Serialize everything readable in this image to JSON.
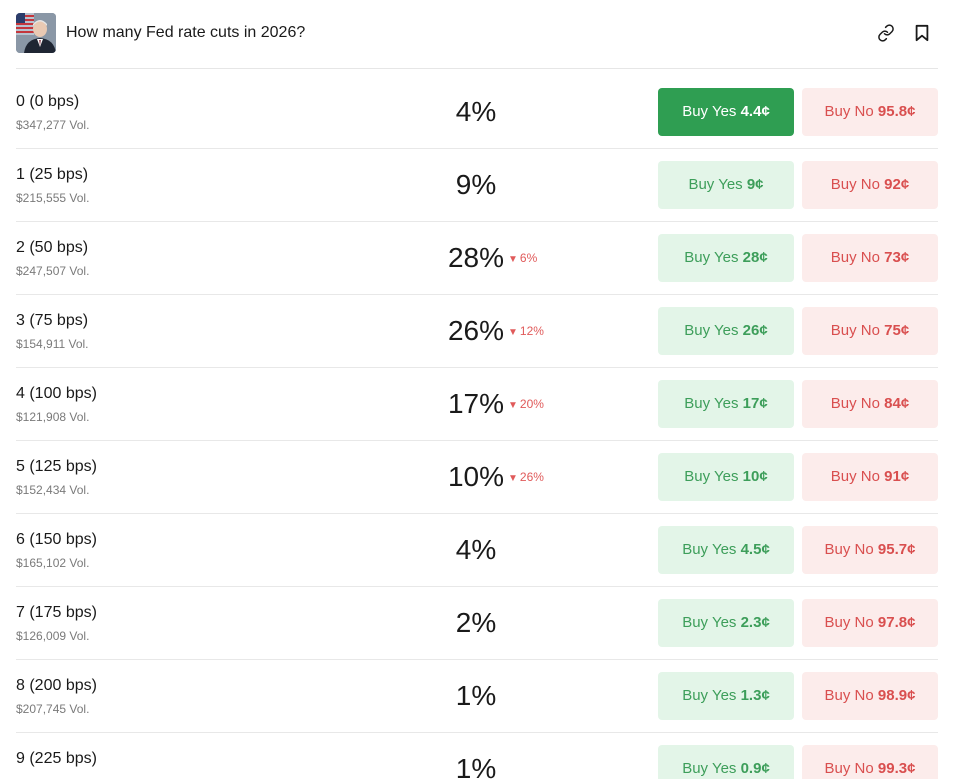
{
  "header": {
    "title": "How many Fed rate cuts in 2026?",
    "icons": {
      "link": "link-icon",
      "bookmark": "bookmark-icon",
      "avatar": "market-avatar"
    }
  },
  "colors": {
    "yes_active_bg": "#2f9e52",
    "yes_bg": "#e3f5e8",
    "yes_text": "#3d9e5a",
    "no_bg": "#fceceb",
    "no_text": "#d94f4f",
    "change_down": "#e05a5a"
  },
  "rows": [
    {
      "label": "0 (0 bps)",
      "vol": "$347,277 Vol.",
      "pct": "4%",
      "change": "",
      "yes_prefix": "Buy Yes",
      "yes_price": "4.4¢",
      "no_prefix": "Buy No",
      "no_price": "95.8¢",
      "yes_active": true
    },
    {
      "label": "1 (25 bps)",
      "vol": "$215,555 Vol.",
      "pct": "9%",
      "change": "",
      "yes_prefix": "Buy Yes",
      "yes_price": "9¢",
      "no_prefix": "Buy No",
      "no_price": "92¢",
      "yes_active": false
    },
    {
      "label": "2 (50 bps)",
      "vol": "$247,507 Vol.",
      "pct": "28%",
      "change": "6%",
      "yes_prefix": "Buy Yes",
      "yes_price": "28¢",
      "no_prefix": "Buy No",
      "no_price": "73¢",
      "yes_active": false
    },
    {
      "label": "3 (75 bps)",
      "vol": "$154,911 Vol.",
      "pct": "26%",
      "change": "12%",
      "yes_prefix": "Buy Yes",
      "yes_price": "26¢",
      "no_prefix": "Buy No",
      "no_price": "75¢",
      "yes_active": false
    },
    {
      "label": "4 (100 bps)",
      "vol": "$121,908 Vol.",
      "pct": "17%",
      "change": "20%",
      "yes_prefix": "Buy Yes",
      "yes_price": "17¢",
      "no_prefix": "Buy No",
      "no_price": "84¢",
      "yes_active": false
    },
    {
      "label": "5 (125 bps)",
      "vol": "$152,434 Vol.",
      "pct": "10%",
      "change": "26%",
      "yes_prefix": "Buy Yes",
      "yes_price": "10¢",
      "no_prefix": "Buy No",
      "no_price": "91¢",
      "yes_active": false
    },
    {
      "label": "6 (150 bps)",
      "vol": "$165,102 Vol.",
      "pct": "4%",
      "change": "",
      "yes_prefix": "Buy Yes",
      "yes_price": "4.5¢",
      "no_prefix": "Buy No",
      "no_price": "95.7¢",
      "yes_active": false
    },
    {
      "label": "7 (175 bps)",
      "vol": "$126,009 Vol.",
      "pct": "2%",
      "change": "",
      "yes_prefix": "Buy Yes",
      "yes_price": "2.3¢",
      "no_prefix": "Buy No",
      "no_price": "97.8¢",
      "yes_active": false
    },
    {
      "label": "8 (200 bps)",
      "vol": "$207,745 Vol.",
      "pct": "1%",
      "change": "",
      "yes_prefix": "Buy Yes",
      "yes_price": "1.3¢",
      "no_prefix": "Buy No",
      "no_price": "98.9¢",
      "yes_active": false
    },
    {
      "label": "9 (225 bps)",
      "vol": "",
      "pct": "1%",
      "change": "",
      "yes_prefix": "Buy Yes",
      "yes_price": "0.9¢",
      "no_prefix": "Buy No",
      "no_price": "99.3¢",
      "yes_active": false
    }
  ]
}
